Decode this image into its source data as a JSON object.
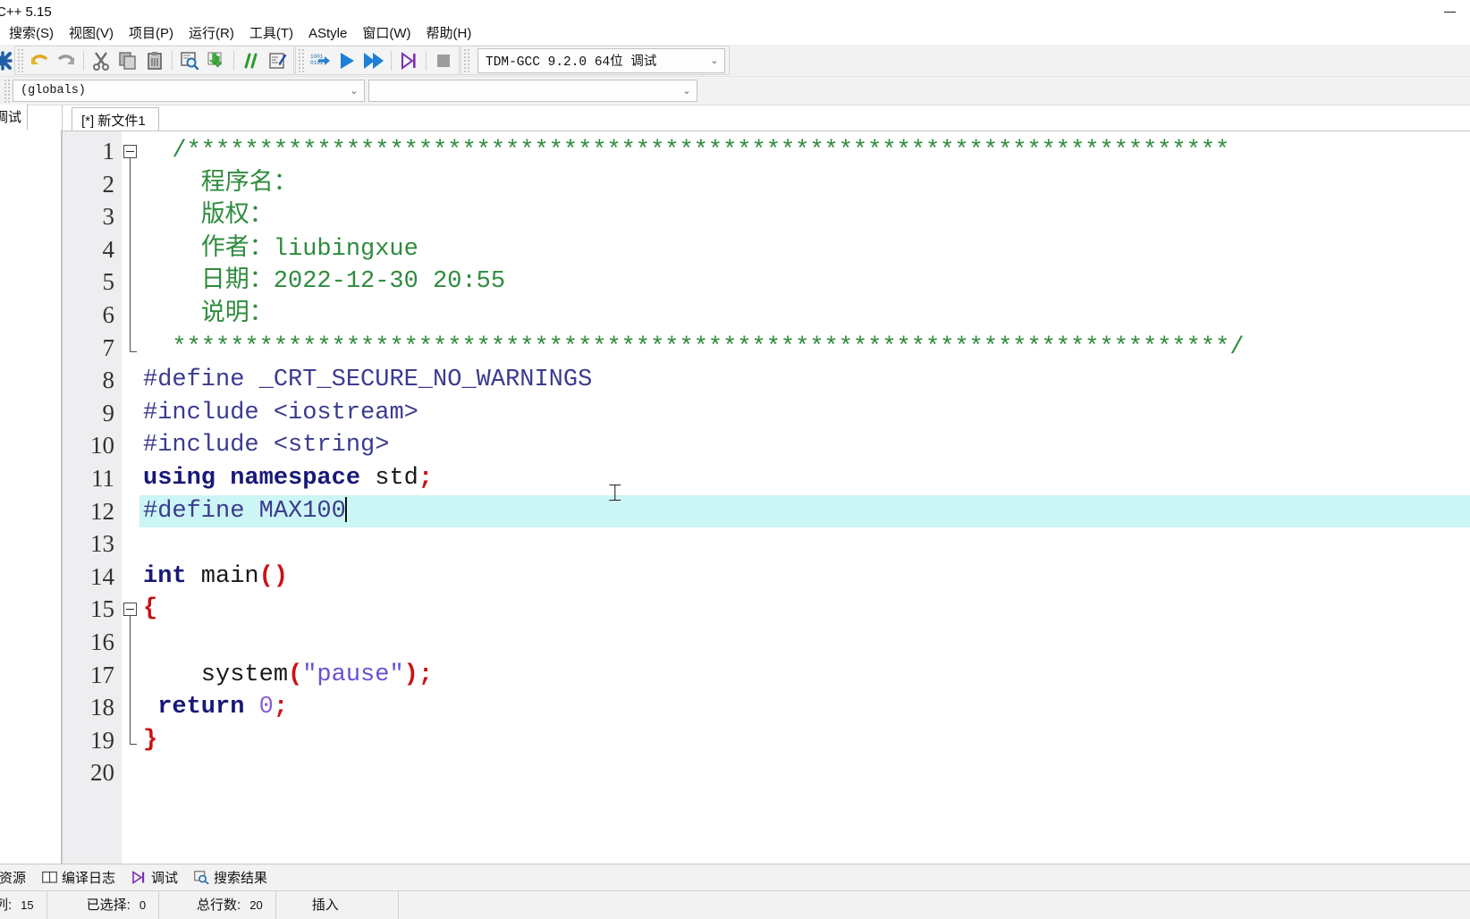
{
  "window": {
    "title": "C++ 5.15",
    "controls": {
      "minimize": "—",
      "maximize": "▢",
      "close": "✕"
    }
  },
  "menubar": {
    "items": [
      {
        "label": "搜索(S)",
        "name": "menu-search"
      },
      {
        "label": "视图(V)",
        "name": "menu-view"
      },
      {
        "label": "项目(P)",
        "name": "menu-project"
      },
      {
        "label": "运行(R)",
        "name": "menu-run"
      },
      {
        "label": "工具(T)",
        "name": "menu-tools"
      },
      {
        "label": "AStyle",
        "name": "menu-astyle"
      },
      {
        "label": "窗口(W)",
        "name": "menu-window"
      },
      {
        "label": "帮助(H)",
        "name": "menu-help"
      }
    ]
  },
  "toolbar": {
    "icons": [
      "close-x-icon",
      "undo-icon",
      "redo-icon",
      "cut-icon",
      "copy-icon",
      "paste-icon",
      "find-icon",
      "replace-icon",
      "comment-icon",
      "indent-icon",
      "compile-icon",
      "run-icon",
      "compile-run-icon",
      "debug-icon",
      "stop-icon"
    ],
    "compiler_select": {
      "value": "TDM-GCC 9.2.0 64位 调试",
      "caret": "⌄"
    }
  },
  "toolbar2": {
    "globals_select": {
      "value": "(globals)",
      "caret": "⌄"
    },
    "scope_select": {
      "value": "",
      "caret": "⌄"
    }
  },
  "left_dock": {
    "tab_label": "调试"
  },
  "editor": {
    "tab_label": "[*] 新文件1",
    "total_lines": 20,
    "highlight_line": 12,
    "lines": [
      {
        "n": 1,
        "tokens": [
          {
            "t": "cmt",
            "s": "  /************************************************************************"
          }
        ]
      },
      {
        "n": 2,
        "tokens": [
          {
            "t": "cmt",
            "s": "    程序名："
          }
        ]
      },
      {
        "n": 3,
        "tokens": [
          {
            "t": "cmt",
            "s": "    版权："
          }
        ]
      },
      {
        "n": 4,
        "tokens": [
          {
            "t": "cmt",
            "s": "    作者：liubingxue"
          }
        ]
      },
      {
        "n": 5,
        "tokens": [
          {
            "t": "cmt",
            "s": "    日期：2022-12-30 20:55"
          }
        ]
      },
      {
        "n": 6,
        "tokens": [
          {
            "t": "cmt",
            "s": "    说明："
          }
        ]
      },
      {
        "n": 7,
        "tokens": [
          {
            "t": "cmt",
            "s": "  *************************************************************************/"
          }
        ]
      },
      {
        "n": 8,
        "tokens": [
          {
            "t": "prep",
            "s": "#define _CRT_SECURE_NO_WARNINGS"
          }
        ]
      },
      {
        "n": 9,
        "tokens": [
          {
            "t": "prep",
            "s": "#include <iostream>"
          }
        ]
      },
      {
        "n": 10,
        "tokens": [
          {
            "t": "prep",
            "s": "#include <string>"
          }
        ]
      },
      {
        "n": 11,
        "tokens": [
          {
            "t": "kw",
            "s": "using namespace"
          },
          {
            "t": "plain",
            "s": " std"
          },
          {
            "t": "punct",
            "s": ";"
          }
        ]
      },
      {
        "n": 12,
        "tokens": [
          {
            "t": "prep",
            "s": "#define MAX100"
          },
          {
            "t": "caret",
            "s": ""
          }
        ]
      },
      {
        "n": 13,
        "tokens": []
      },
      {
        "n": 14,
        "tokens": [
          {
            "t": "kw",
            "s": "int"
          },
          {
            "t": "plain",
            "s": " main"
          },
          {
            "t": "punct",
            "s": "()"
          }
        ]
      },
      {
        "n": 15,
        "tokens": [
          {
            "t": "brace",
            "s": "{"
          }
        ]
      },
      {
        "n": 16,
        "tokens": []
      },
      {
        "n": 17,
        "tokens": [
          {
            "t": "plain",
            "s": "    system"
          },
          {
            "t": "punct",
            "s": "("
          },
          {
            "t": "str",
            "s": "\"pause\""
          },
          {
            "t": "punct",
            "s": ");"
          }
        ]
      },
      {
        "n": 18,
        "tokens": [
          {
            "t": "plain",
            "s": " "
          },
          {
            "t": "kw",
            "s": "return"
          },
          {
            "t": "plain",
            "s": " "
          },
          {
            "t": "num",
            "s": "0"
          },
          {
            "t": "punct",
            "s": ";"
          }
        ]
      },
      {
        "n": 19,
        "tokens": [
          {
            "t": "brace",
            "s": "}"
          }
        ]
      },
      {
        "n": 20,
        "tokens": []
      }
    ],
    "fold_regions": [
      {
        "start": 1,
        "end": 7
      },
      {
        "start": 15,
        "end": 19
      }
    ],
    "mouse_cursor_glyph": "⌶"
  },
  "bottom_tabs": [
    {
      "label": "资源",
      "icon": "resources-icon"
    },
    {
      "label": "编译日志",
      "icon": "compile-log-icon"
    },
    {
      "label": "调试",
      "icon": "debug-icon"
    },
    {
      "label": "搜索结果",
      "icon": "search-results-icon"
    }
  ],
  "statusbar": {
    "col_label": "列:",
    "col_value": "15",
    "sel_label": "已选择:",
    "sel_value": "0",
    "lines_label": "总行数:",
    "lines_value": "20",
    "mode": "插入"
  },
  "colors": {
    "comment": "#2e8b3d",
    "preprocessor": "#3b3b8f",
    "keyword": "#181878",
    "string": "#6a4fd0",
    "number": "#8a5fd6",
    "punctuation": "#cc1111",
    "line_highlight": "#ccf5f5",
    "gutter_bg": "#eeeef1",
    "toolbar_bg": "#f2f2f2"
  }
}
